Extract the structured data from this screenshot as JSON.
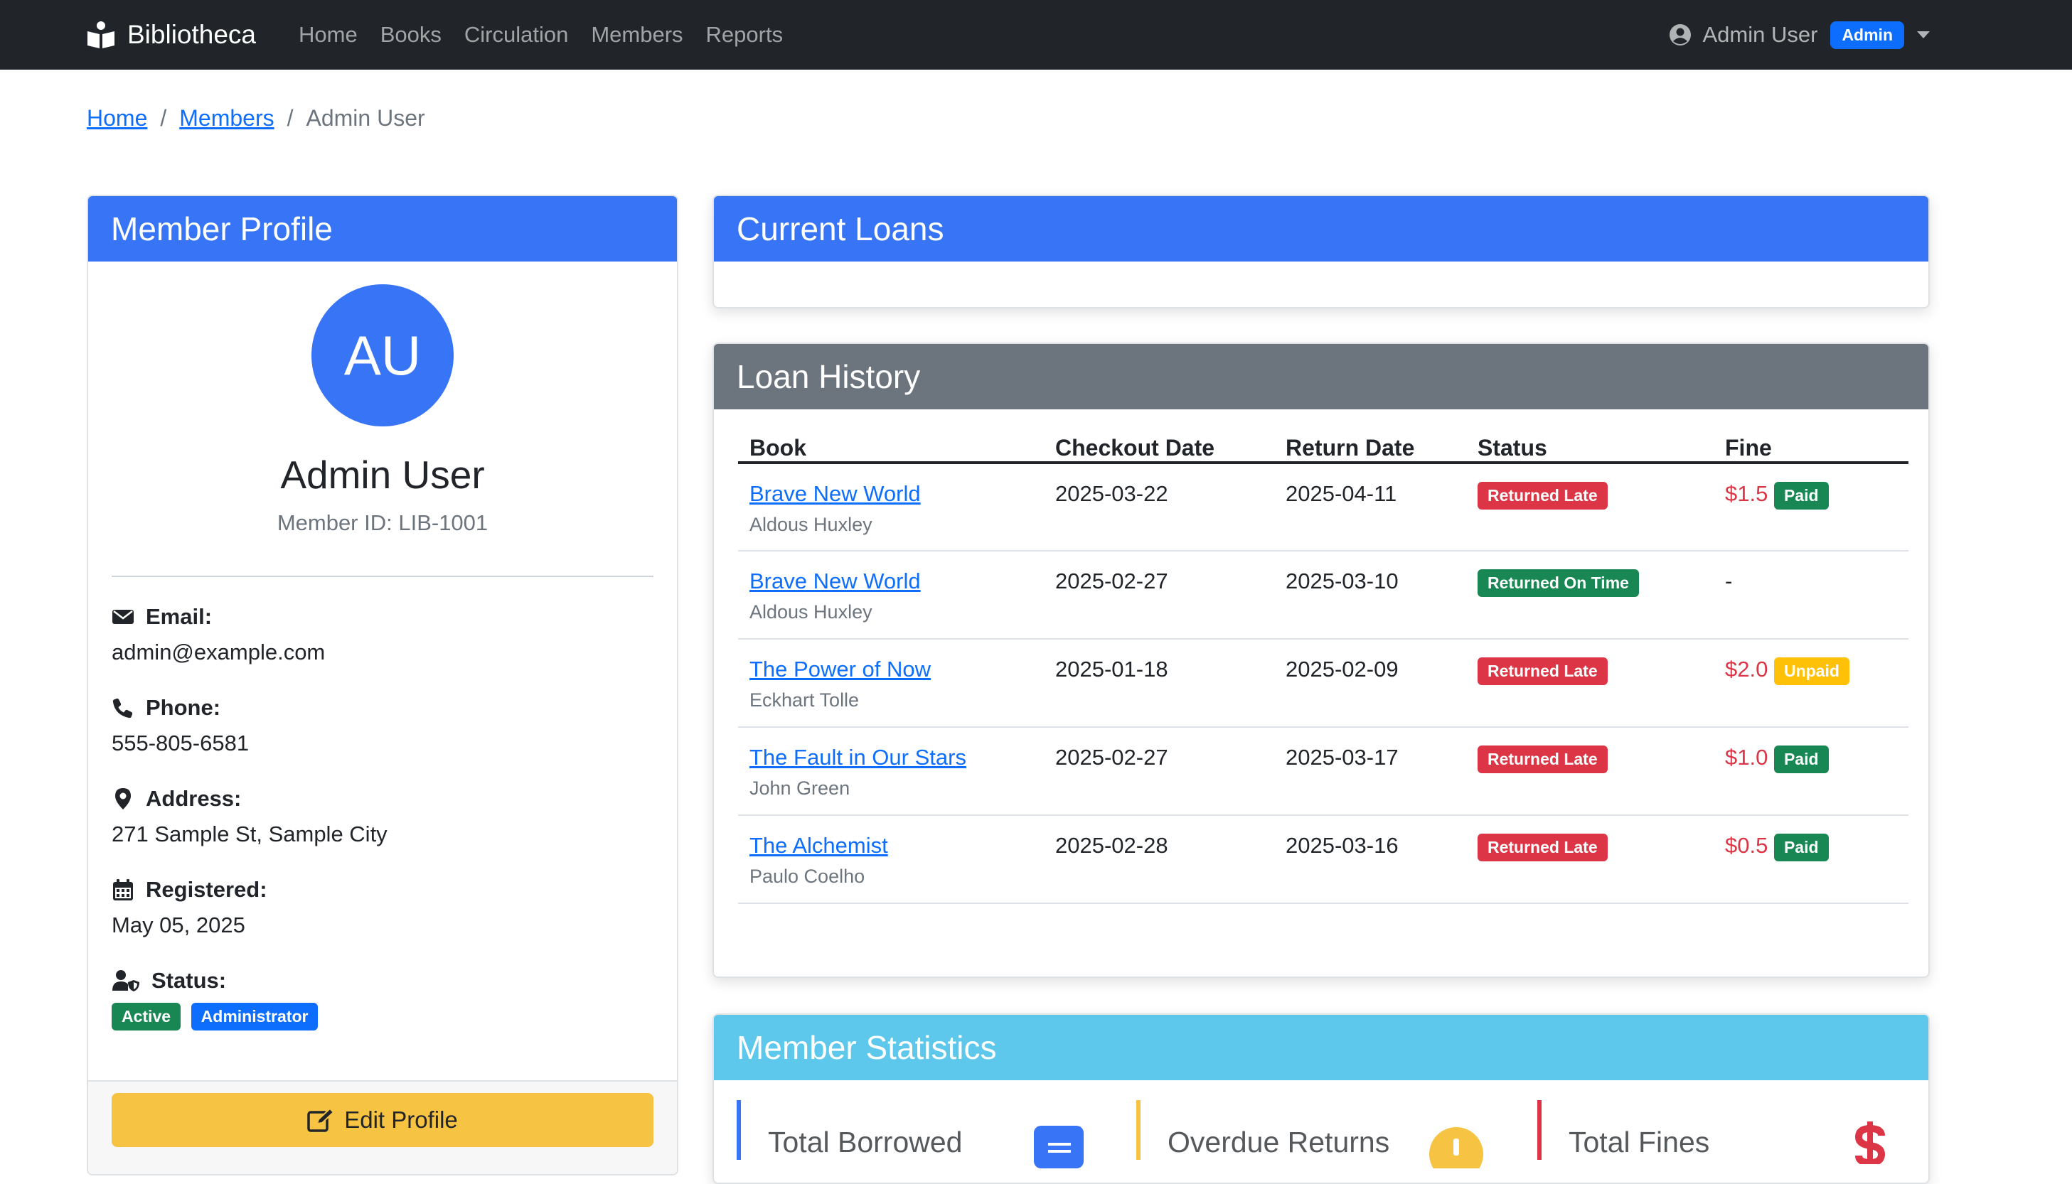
{
  "navbar": {
    "brand": "Bibliotheca",
    "links": [
      "Home",
      "Books",
      "Circulation",
      "Members",
      "Reports"
    ],
    "user_name": "Admin User",
    "user_role": "Admin"
  },
  "breadcrumb": {
    "items": [
      "Home",
      "Members"
    ],
    "current": "Admin User",
    "separator": "/"
  },
  "profile": {
    "header": "Member Profile",
    "initials": "AU",
    "name": "Admin User",
    "member_id": "Member ID: LIB-1001",
    "email_label": "Email:",
    "email": "admin@example.com",
    "phone_label": "Phone:",
    "phone": "555-805-6581",
    "address_label": "Address:",
    "address": "271 Sample St, Sample City",
    "registered_label": "Registered:",
    "registered": "May 05, 2025",
    "status_label": "Status:",
    "status_badges": [
      "Active",
      "Administrator"
    ],
    "edit_button": "Edit Profile"
  },
  "current_loans": {
    "header": "Current Loans"
  },
  "loan_history": {
    "header": "Loan History",
    "columns": [
      "Book",
      "Checkout Date",
      "Return Date",
      "Status",
      "Fine"
    ],
    "rows": [
      {
        "title": "Brave New World",
        "author": "Aldous Huxley",
        "checkout": "2025-03-22",
        "return": "2025-04-11",
        "status": "Returned Late",
        "fine": "$1.5",
        "fine_status": "Paid"
      },
      {
        "title": "Brave New World",
        "author": "Aldous Huxley",
        "checkout": "2025-02-27",
        "return": "2025-03-10",
        "status": "Returned On Time",
        "fine": "-",
        "fine_status": ""
      },
      {
        "title": "The Power of Now",
        "author": "Eckhart Tolle",
        "checkout": "2025-01-18",
        "return": "2025-02-09",
        "status": "Returned Late",
        "fine": "$2.0",
        "fine_status": "Unpaid"
      },
      {
        "title": "The Fault in Our Stars",
        "author": "John Green",
        "checkout": "2025-02-27",
        "return": "2025-03-17",
        "status": "Returned Late",
        "fine": "$1.0",
        "fine_status": "Paid"
      },
      {
        "title": "The Alchemist",
        "author": "Paulo Coelho",
        "checkout": "2025-02-28",
        "return": "2025-03-16",
        "status": "Returned Late",
        "fine": "$0.5",
        "fine_status": "Paid"
      }
    ]
  },
  "statistics": {
    "header": "Member Statistics",
    "cards": [
      {
        "label": "Total Borrowed",
        "icon": "book-icon"
      },
      {
        "label": "Overdue Returns",
        "icon": "exclamation-icon"
      },
      {
        "label": "Total Fines",
        "icon": "dollar-icon"
      }
    ]
  },
  "colors": {
    "primary": "#3874f6",
    "secondary": "#6c757d",
    "info": "#5ec8ec",
    "success": "#198754",
    "danger": "#dc3545",
    "warning": "#ffc107",
    "navbar": "#212529"
  }
}
